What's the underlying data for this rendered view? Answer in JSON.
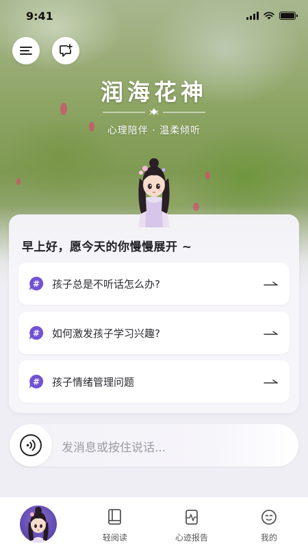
{
  "status_bar": {
    "time": "9:41"
  },
  "header": {
    "title": "润海花神",
    "subtitle": "心理陪伴 · 温柔倾听"
  },
  "card": {
    "greeting": "早上好，愿今天的你慢慢展开 ~",
    "questions": [
      {
        "label": "孩子总是不听话怎么办?"
      },
      {
        "label": "如何激发孩子学习兴趣?"
      },
      {
        "label": "孩子情绪管理问题"
      }
    ]
  },
  "input": {
    "placeholder": "发消息或按住说话..."
  },
  "tabbar": {
    "tabs": [
      {
        "label": "轻阅读",
        "icon": "book-icon"
      },
      {
        "label": "心迹报告",
        "icon": "report-icon"
      },
      {
        "label": "我的",
        "icon": "smile-icon"
      }
    ]
  },
  "colors": {
    "accent": "#6e52d0",
    "background": "#efeef4"
  }
}
